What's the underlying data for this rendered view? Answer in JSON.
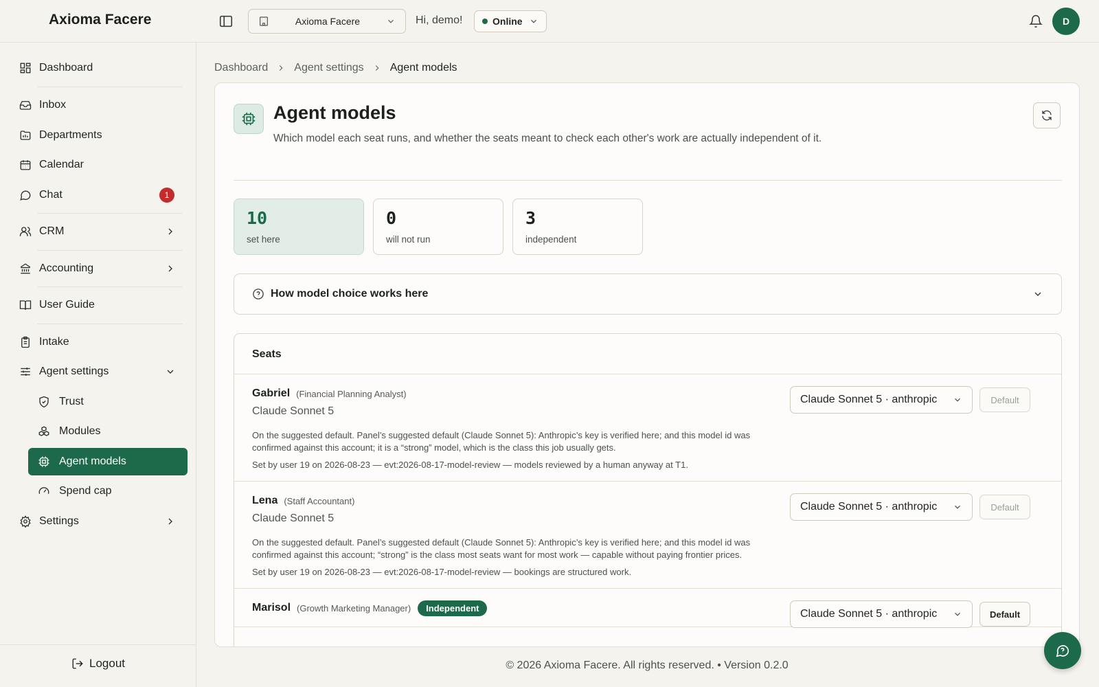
{
  "app": {
    "brand": "Axioma Facere",
    "org_select": "Axioma Facere",
    "greeting": "Hi, demo!",
    "status": "Online",
    "avatar_initial": "D"
  },
  "colors": {
    "accent": "#1d6a4a",
    "badge": "#c42b2b",
    "background": "#f5f3ee"
  },
  "sidebar": {
    "items": [
      {
        "label": "Dashboard",
        "icon": "dashboard-icon"
      },
      {
        "label": "Inbox",
        "icon": "inbox-icon"
      },
      {
        "label": "Departments",
        "icon": "folder-icon"
      },
      {
        "label": "Calendar",
        "icon": "calendar-icon"
      },
      {
        "label": "Chat",
        "icon": "chat-icon",
        "badge": "1"
      },
      {
        "label": "CRM",
        "icon": "users-icon"
      },
      {
        "label": "Accounting",
        "icon": "bank-icon"
      },
      {
        "label": "User Guide",
        "icon": "book-icon"
      },
      {
        "label": "Intake",
        "icon": "clipboard-icon"
      },
      {
        "label": "Agent settings",
        "icon": "sliders-icon",
        "expanded": true
      },
      {
        "label": "Trust",
        "icon": "shield-icon"
      },
      {
        "label": "Modules",
        "icon": "boxes-icon"
      },
      {
        "label": "Agent models",
        "icon": "cpu-icon",
        "active": true
      },
      {
        "label": "Spend cap",
        "icon": "gauge-icon"
      },
      {
        "label": "Settings",
        "icon": "gear-icon"
      }
    ],
    "logout": "Logout"
  },
  "breadcrumb": [
    "Dashboard",
    "Agent settings",
    "Agent models"
  ],
  "page": {
    "title": "Agent models",
    "description": "Which model each seat runs, and whether the seats meant to check each other's work are actually independent of it."
  },
  "stats": [
    {
      "value": "10",
      "label": "set here"
    },
    {
      "value": "0",
      "label": "will not run"
    },
    {
      "value": "3",
      "label": "independent"
    }
  ],
  "accordion": {
    "label": "How model choice works here"
  },
  "seats": {
    "title": "Seats",
    "rows": [
      {
        "name": "Gabriel",
        "role": "(Financial Planning Analyst)",
        "model": "Claude Sonnet 5",
        "reason": "On the suggested default. Panel’s suggested default (Claude Sonnet 5): Anthropic’s key is verified here; and this model id was confirmed against this account; it is a “strong” model, which is the class this job usually gets.",
        "set_by": "Set by user 19 on 2026-08-23 — evt:2026-08-17-model-review — models reviewed by a human anyway at T1.",
        "select": "Claude Sonnet 5 · anthropic",
        "default_label": "Default"
      },
      {
        "name": "Lena",
        "role": "(Staff Accountant)",
        "model": "Claude Sonnet 5",
        "reason": "On the suggested default. Panel’s suggested default (Claude Sonnet 5): Anthropic’s key is verified here; and this model id was confirmed against this account; “strong” is the class most seats want for most work — capable without paying frontier prices.",
        "set_by": "Set by user 19 on 2026-08-23 — evt:2026-08-17-model-review — bookings are structured work.",
        "select": "Claude Sonnet 5 · anthropic",
        "default_label": "Default"
      },
      {
        "name": "Marisol",
        "role": "(Growth Marketing Manager)",
        "tag": "Independent",
        "select": "Claude Sonnet 5 · anthropic",
        "default_label": "Default"
      }
    ]
  },
  "footer": "© 2026 Axioma Facere. All rights reserved. • Version 0.2.0"
}
